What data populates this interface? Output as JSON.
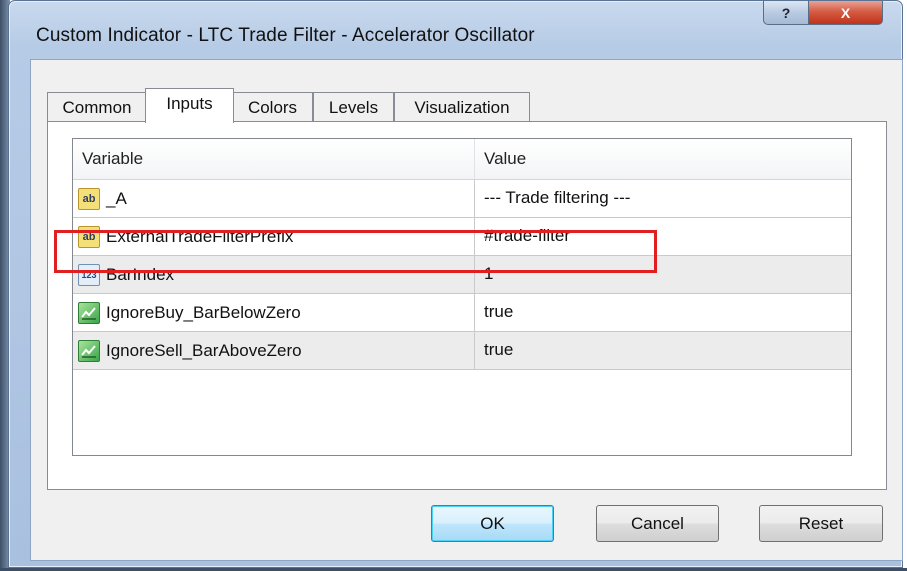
{
  "window": {
    "title": "Custom Indicator - LTC Trade Filter - Accelerator Oscillator",
    "help_label": "?",
    "close_label": "X"
  },
  "tabs": [
    {
      "label": "Common",
      "active": false
    },
    {
      "label": "Inputs",
      "active": true
    },
    {
      "label": "Colors",
      "active": false
    },
    {
      "label": "Levels",
      "active": false
    },
    {
      "label": "Visualization",
      "active": false
    }
  ],
  "table": {
    "columns": [
      "Variable",
      "Value"
    ],
    "rows": [
      {
        "icon": "string-ab-icon",
        "icon_text": "ab",
        "variable": "_A",
        "value": "--- Trade filtering ---"
      },
      {
        "icon": "string-ab-icon",
        "icon_text": "ab",
        "variable": "ExternalTradeFilterPrefix",
        "value": "#trade-filter",
        "highlighted": true
      },
      {
        "icon": "integer-123-icon",
        "icon_text": "123",
        "variable": "BarIndex",
        "value": "1"
      },
      {
        "icon": "boolean-icon",
        "icon_text": "",
        "variable": "IgnoreBuy_BarBelowZero",
        "value": "true"
      },
      {
        "icon": "boolean-icon",
        "icon_text": "",
        "variable": "IgnoreSell_BarAboveZero",
        "value": "true"
      }
    ]
  },
  "buttons": {
    "ok": "OK",
    "cancel": "Cancel",
    "reset": "Reset"
  },
  "colors": {
    "highlight_border": "#e02020",
    "close_button": "#c1311a"
  }
}
